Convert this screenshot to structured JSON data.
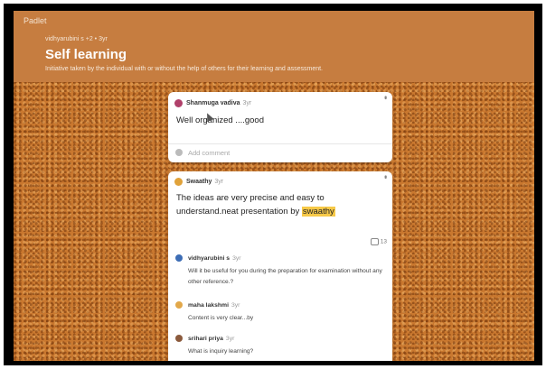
{
  "app": {
    "name": "Padlet"
  },
  "header": {
    "authors": "vidhyarubini s +2 • 3yr",
    "title": "Self learning",
    "subtitle": "Initiative taken by the individual with or without the help of others for their learning and assessment."
  },
  "posts": [
    {
      "author": "Shanmuga vadiva",
      "time": "3yr",
      "text": "Well organized ....good",
      "add_comment_placeholder": "Add comment"
    },
    {
      "author": "Swaathy",
      "time": "3yr",
      "text_before": "The ideas are very precise and easy to understand.neat presentation by ",
      "text_highlight": "swaathy",
      "comment_count": "13",
      "comments": [
        {
          "author": "vidhyarubini s",
          "time": "3yr",
          "text": "Will it be useful for you during the preparation for examination without any other reference.?"
        },
        {
          "author": "maha lakshmi",
          "time": "3yr",
          "text": "Content is very clear...by"
        },
        {
          "author": "srihari priya",
          "time": "3yr",
          "text": "What is inquiry learning?"
        }
      ]
    }
  ],
  "colors": {
    "header": "#c67d40",
    "cork": "#c9782f",
    "highlight": "#f7c948"
  },
  "icons": [
    "menu-dots-icon",
    "comment-bubble-icon",
    "cursor-icon"
  ]
}
